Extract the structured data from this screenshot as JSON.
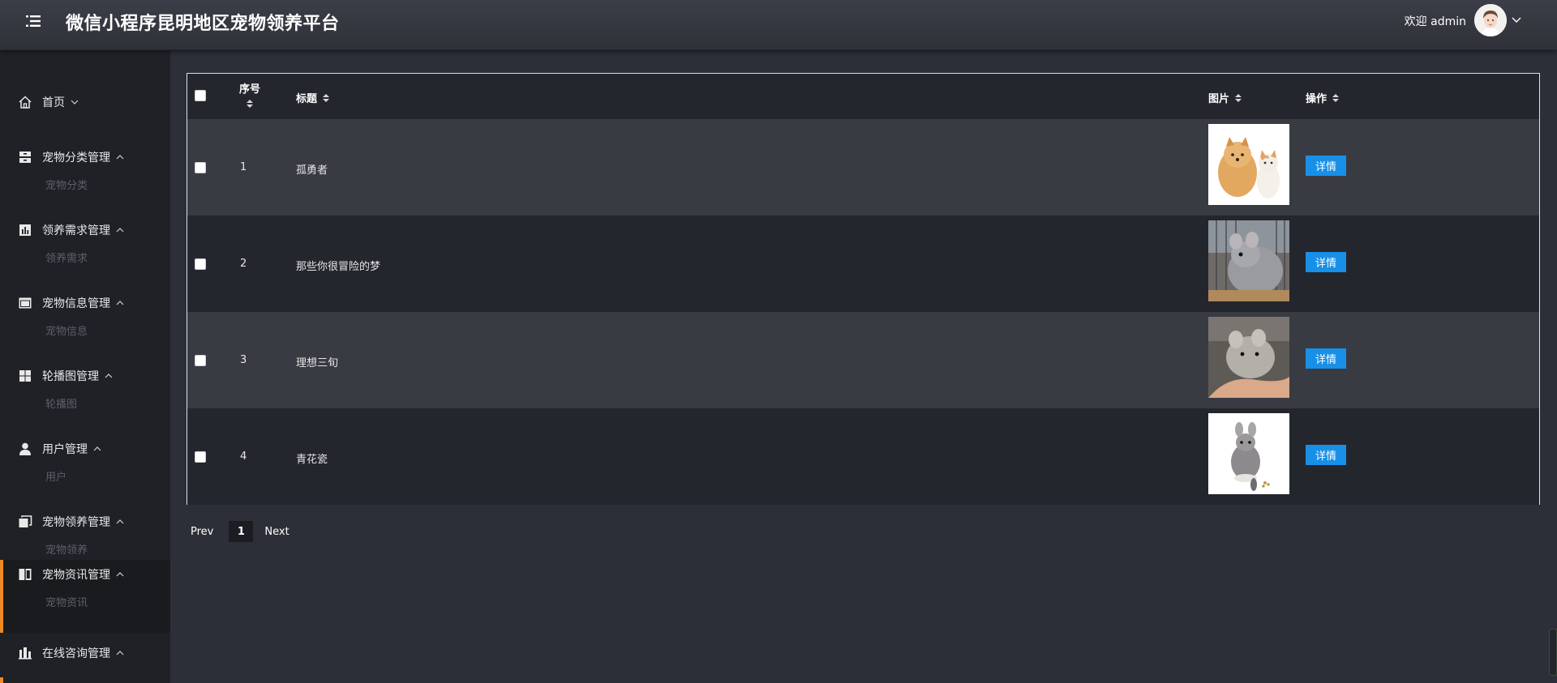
{
  "header": {
    "title": "微信小程序昆明地区宠物领养平台",
    "welcome": "欢迎 admin",
    "menu_icon": "menu-toggle-icon",
    "avatar_icon": "user-avatar"
  },
  "sidebar": {
    "items": [
      {
        "label": "首页",
        "icon": "home-icon",
        "sub": null
      },
      {
        "label": "宠物分类管理",
        "icon": "category-icon",
        "sub": "宠物分类"
      },
      {
        "label": "领养需求管理",
        "icon": "bar-chart-icon",
        "sub": "领养需求"
      },
      {
        "label": "宠物信息管理",
        "icon": "card-icon",
        "sub": "宠物信息"
      },
      {
        "label": "轮播图管理",
        "icon": "grid-icon",
        "sub": "轮播图"
      },
      {
        "label": "用户管理",
        "icon": "user-icon",
        "sub": "用户"
      },
      {
        "label": "宠物领养管理",
        "icon": "copy-icon",
        "sub": "宠物领养"
      },
      {
        "label": "宠物资讯管理",
        "icon": "book-icon",
        "sub": "宠物资讯",
        "active": true
      },
      {
        "label": "在线咨询管理",
        "icon": "bank-icon",
        "sub": null
      }
    ]
  },
  "table": {
    "columns": {
      "index": "序号",
      "title": "标题",
      "image": "图片",
      "action": "操作"
    },
    "rows": [
      {
        "index": "1",
        "title": "孤勇者",
        "image": "dog-and-cat-photo",
        "action": "详情"
      },
      {
        "index": "2",
        "title": "那些你很冒险的梦",
        "image": "chinchilla-in-cage-photo",
        "action": "详情"
      },
      {
        "index": "3",
        "title": "理想三旬",
        "image": "chinchilla-in-hand-photo",
        "action": "详情"
      },
      {
        "index": "4",
        "title": "青花瓷",
        "image": "chinchilla-white-background-photo",
        "action": "详情"
      }
    ]
  },
  "pagination": {
    "prev": "Prev",
    "page": "1",
    "next": "Next"
  },
  "colors": {
    "accent": "#f08a24",
    "button": "#1890e8",
    "sidebar_bg": "#1f2126",
    "main_bg": "#2c2f37"
  }
}
